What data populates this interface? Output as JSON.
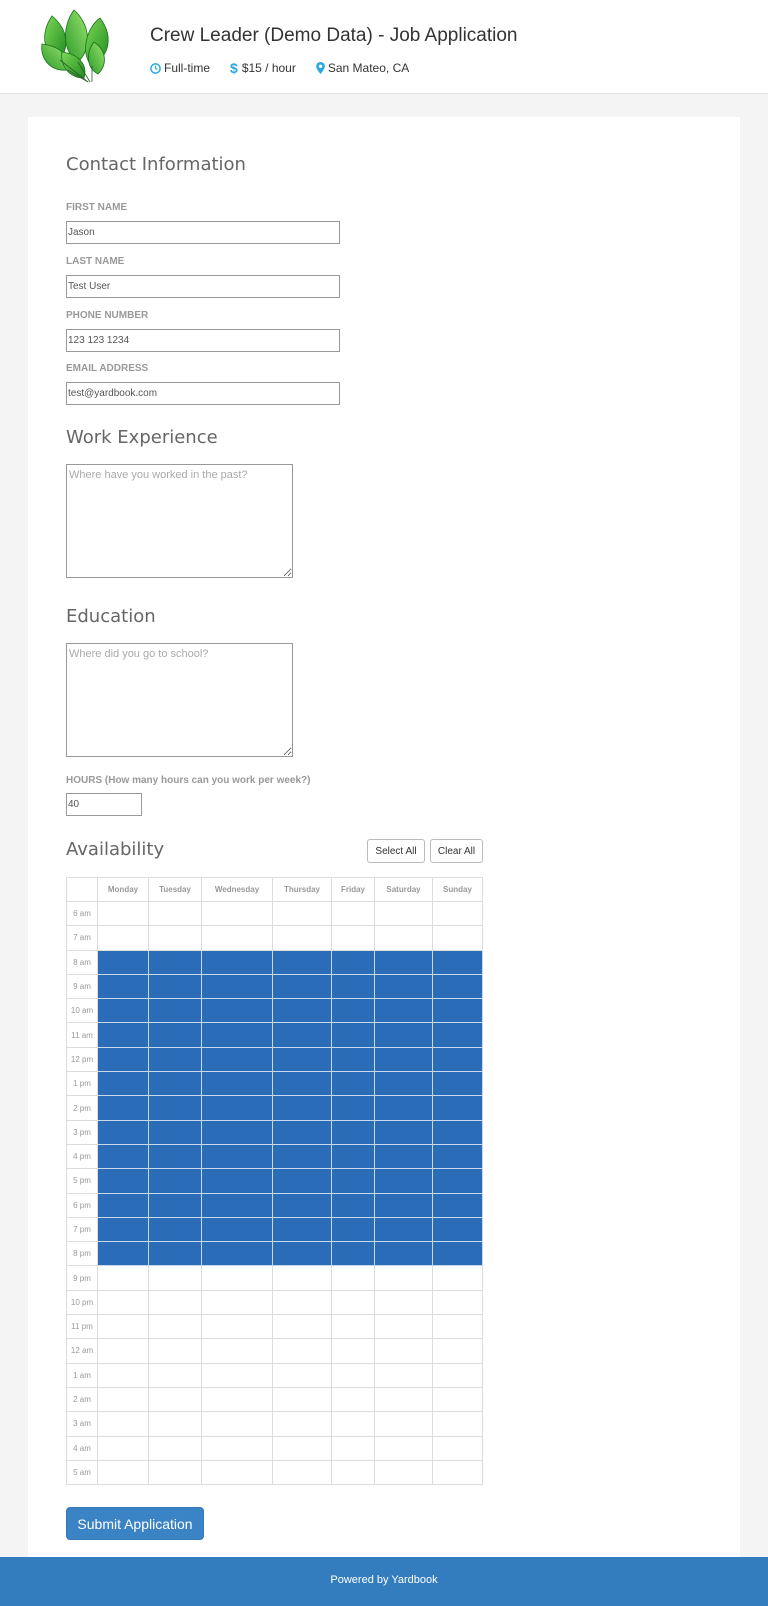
{
  "header": {
    "title": "Crew Leader (Demo Data) - Job Application",
    "job_type": "Full-time",
    "pay": "$15 / hour",
    "location": "San Mateo, CA",
    "accent_color": "#29a9e0"
  },
  "contact": {
    "title": "Contact Information",
    "first_name_label": "FIRST NAME",
    "first_name_value": "Jason",
    "last_name_label": "LAST NAME",
    "last_name_value": "Test User",
    "phone_label": "PHONE NUMBER",
    "phone_value": "123 123 1234",
    "email_label": "EMAIL ADDRESS",
    "email_value": "test@yardbook.com"
  },
  "work": {
    "title": "Work Experience",
    "placeholder": "Where have you worked in the past?"
  },
  "education": {
    "title": "Education",
    "placeholder": "Where did you go to school?"
  },
  "hours": {
    "label": "HOURS (How many hours can you work per week?)",
    "value": "40"
  },
  "availability": {
    "title": "Availability",
    "select_all_label": "Select All",
    "clear_all_label": "Clear All",
    "days": [
      "Monday",
      "Tuesday",
      "Wednesday",
      "Thursday",
      "Friday",
      "Saturday",
      "Sunday"
    ],
    "times": [
      "6 am",
      "7 am",
      "8 am",
      "9 am",
      "10 am",
      "11 am",
      "12 pm",
      "1 pm",
      "2 pm",
      "3 pm",
      "4 pm",
      "5 pm",
      "6 pm",
      "7 pm",
      "8 pm",
      "9 pm",
      "10 pm",
      "11 pm",
      "12 am",
      "1 am",
      "2 am",
      "3 am",
      "4 am",
      "5 am"
    ],
    "selected_times": [
      "8 am",
      "9 am",
      "10 am",
      "11 am",
      "12 pm",
      "1 pm",
      "2 pm",
      "3 pm",
      "4 pm",
      "5 pm",
      "6 pm",
      "7 pm",
      "8 pm"
    ],
    "selected_color": "#2b6cb9"
  },
  "submit_label": "Submit Application",
  "footer": {
    "text": "Powered by Yardbook"
  }
}
